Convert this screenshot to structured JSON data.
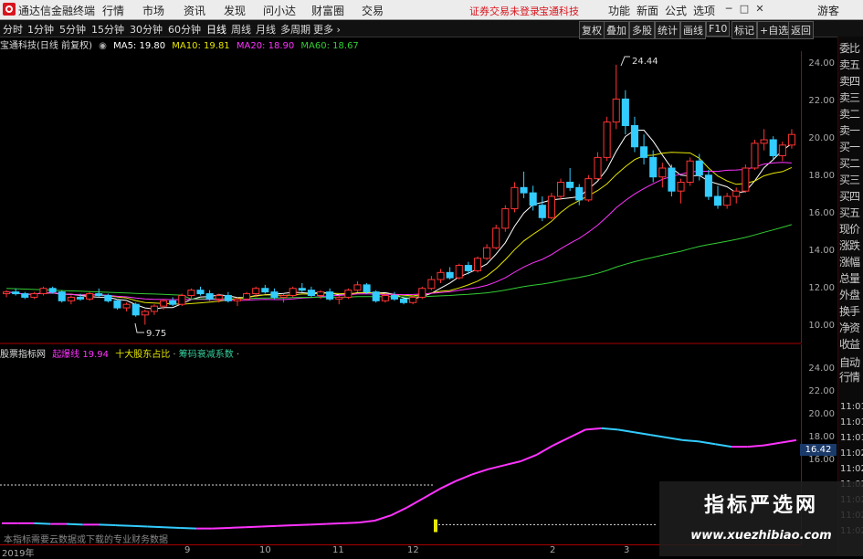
{
  "window": {
    "app_title": "通达信金融终端",
    "menu": [
      "行情",
      "市场",
      "资讯",
      "发现",
      "问小达",
      "财富圈",
      "交易"
    ],
    "notice": "证券交易未登录",
    "notice_stock": "宝通科技",
    "right_menu": [
      "功能",
      "新面",
      "公式",
      "选项"
    ],
    "guest": "游客"
  },
  "periods": [
    "分时",
    "1分钟",
    "5分钟",
    "15分钟",
    "30分钟",
    "60分钟",
    "日线",
    "周线",
    "月线",
    "多周期",
    "更多 ›"
  ],
  "active_period": "日线",
  "right_tools": [
    "复权",
    "叠加",
    "多股",
    "统计",
    "画线",
    "F10",
    "标记",
    "+自选",
    "返回"
  ],
  "main_info": {
    "stock": "宝通科技(日线 前复权)",
    "ma5": "MA5: 19.80",
    "ma10": "MA10: 19.81",
    "ma20": "MA20: 18.90",
    "ma60": "MA60: 18.67"
  },
  "price_axis": [
    "24.00",
    "22.00",
    "20.00",
    "18.00",
    "16.00",
    "14.00",
    "12.00",
    "10.00"
  ],
  "annotations": {
    "high": "24.44",
    "low": "9.75"
  },
  "sub_info": {
    "source": "股票指标网",
    "line_name": "起爆线",
    "line_value": "19.94",
    "holder": "十大股东占比",
    "chip": "筹码衰减系数"
  },
  "sub_axis": [
    "24.00",
    "22.00",
    "20.00",
    "18.00",
    "16.00"
  ],
  "current_value": "16.42",
  "side_panel": [
    "委比",
    "卖五",
    "卖四",
    "卖三",
    "卖二",
    "卖一",
    "买一",
    "买二",
    "买三",
    "买四",
    "买五",
    "现价",
    "涨跌",
    "涨幅",
    "总量",
    "外盘",
    "换手",
    "净资",
    "收益"
  ],
  "side_bottom": [
    "自动",
    "行情"
  ],
  "side_times": [
    "11:01",
    "11:01",
    "11:01",
    "11:02",
    "11:02",
    "11:02",
    "11:02",
    "11:02",
    "11:02"
  ],
  "bottom_note": "本指标需要云数据或下载的专业财务数据",
  "x_axis": [
    "2019年",
    "9",
    "10",
    "11",
    "12",
    "2",
    "3"
  ],
  "watermark": {
    "title": "指标严选网",
    "url": "www.xuezhibiao.com"
  },
  "colors": {
    "ma5": "#ffffff",
    "ma10": "#e6e600",
    "ma20": "#ff33ff",
    "ma60": "#33cc33",
    "up": "#ff3333",
    "down": "#33ccff",
    "sub_up": "#ff33ff",
    "sub_down": "#33ccff"
  },
  "chart_data": {
    "type": "candlestick",
    "ylim": [
      9,
      25
    ],
    "sub_ylim": [
      14,
      26
    ],
    "candles": [
      [
        11.5,
        11.7,
        11.3,
        11.6
      ],
      [
        11.6,
        11.8,
        11.4,
        11.5
      ],
      [
        11.5,
        11.6,
        11.2,
        11.3
      ],
      [
        11.3,
        11.6,
        11.2,
        11.5
      ],
      [
        11.5,
        11.9,
        11.4,
        11.8
      ],
      [
        11.8,
        11.9,
        11.5,
        11.6
      ],
      [
        11.6,
        11.7,
        11.0,
        11.1
      ],
      [
        11.1,
        11.4,
        10.9,
        11.3
      ],
      [
        11.3,
        11.5,
        11.1,
        11.2
      ],
      [
        11.2,
        11.6,
        11.1,
        11.5
      ],
      [
        11.5,
        11.8,
        11.3,
        11.4
      ],
      [
        11.4,
        11.5,
        11.0,
        11.1
      ],
      [
        11.1,
        11.2,
        10.6,
        10.7
      ],
      [
        10.7,
        11.0,
        10.5,
        10.9
      ],
      [
        10.9,
        11.0,
        10.2,
        10.3
      ],
      [
        10.3,
        10.6,
        9.75,
        10.5
      ],
      [
        10.5,
        10.9,
        10.3,
        10.8
      ],
      [
        10.8,
        11.2,
        10.6,
        11.1
      ],
      [
        11.1,
        11.3,
        10.8,
        10.9
      ],
      [
        10.9,
        11.5,
        10.8,
        11.4
      ],
      [
        11.4,
        11.8,
        11.2,
        11.7
      ],
      [
        11.7,
        11.9,
        11.4,
        11.5
      ],
      [
        11.5,
        11.7,
        11.1,
        11.2
      ],
      [
        11.2,
        11.5,
        11.0,
        11.4
      ],
      [
        11.4,
        11.6,
        11.0,
        11.1
      ],
      [
        11.1,
        11.3,
        10.8,
        11.2
      ],
      [
        11.2,
        11.6,
        11.1,
        11.5
      ],
      [
        11.5,
        11.9,
        11.3,
        11.8
      ],
      [
        11.8,
        12.0,
        11.5,
        11.6
      ],
      [
        11.6,
        11.8,
        11.2,
        11.3
      ],
      [
        11.3,
        11.5,
        11.0,
        11.4
      ],
      [
        11.4,
        11.9,
        11.3,
        11.8
      ],
      [
        11.8,
        12.1,
        11.6,
        11.7
      ],
      [
        11.7,
        11.9,
        11.3,
        11.4
      ],
      [
        11.4,
        11.7,
        11.2,
        11.6
      ],
      [
        11.6,
        11.8,
        11.1,
        11.2
      ],
      [
        11.2,
        11.4,
        10.9,
        11.3
      ],
      [
        11.3,
        11.8,
        11.2,
        11.7
      ],
      [
        11.7,
        12.2,
        11.6,
        12.0
      ],
      [
        12.0,
        12.1,
        11.5,
        11.6
      ],
      [
        11.6,
        11.7,
        11.0,
        11.1
      ],
      [
        11.1,
        11.5,
        11.0,
        11.4
      ],
      [
        11.4,
        11.6,
        11.1,
        11.2
      ],
      [
        11.2,
        11.3,
        10.9,
        11.0
      ],
      [
        11.0,
        11.4,
        10.9,
        11.3
      ],
      [
        11.3,
        11.9,
        11.2,
        11.8
      ],
      [
        11.8,
        12.5,
        11.7,
        12.3
      ],
      [
        12.3,
        12.9,
        12.1,
        12.7
      ],
      [
        12.7,
        13.0,
        12.3,
        12.4
      ],
      [
        12.4,
        13.2,
        12.3,
        13.1
      ],
      [
        13.1,
        13.3,
        12.6,
        12.8
      ],
      [
        12.8,
        13.6,
        12.7,
        13.5
      ],
      [
        13.5,
        14.3,
        13.4,
        14.1
      ],
      [
        14.1,
        15.4,
        14.0,
        15.2
      ],
      [
        15.2,
        16.5,
        15.0,
        16.3
      ],
      [
        16.3,
        17.8,
        16.1,
        17.5
      ],
      [
        17.5,
        18.4,
        16.9,
        17.2
      ],
      [
        17.2,
        17.6,
        16.2,
        16.5
      ],
      [
        16.5,
        17.0,
        15.6,
        15.8
      ],
      [
        15.8,
        17.2,
        15.7,
        17.0
      ],
      [
        17.0,
        18.0,
        16.8,
        17.8
      ],
      [
        17.8,
        18.6,
        17.3,
        17.5
      ],
      [
        17.5,
        17.7,
        16.5,
        16.8
      ],
      [
        16.8,
        18.2,
        16.7,
        18.0
      ],
      [
        18.0,
        19.5,
        17.9,
        19.2
      ],
      [
        19.2,
        21.5,
        19.0,
        21.2
      ],
      [
        21.2,
        24.44,
        20.8,
        22.5
      ],
      [
        22.5,
        23.0,
        20.5,
        21.0
      ],
      [
        21.0,
        21.5,
        19.5,
        19.8
      ],
      [
        19.8,
        20.5,
        18.8,
        19.2
      ],
      [
        19.2,
        19.6,
        17.8,
        18.1
      ],
      [
        18.1,
        18.9,
        17.5,
        18.6
      ],
      [
        18.6,
        18.8,
        17.0,
        17.3
      ],
      [
        17.3,
        18.0,
        16.6,
        17.8
      ],
      [
        17.8,
        19.2,
        17.6,
        19.0
      ],
      [
        19.0,
        19.4,
        17.9,
        18.2
      ],
      [
        18.2,
        18.5,
        16.8,
        17.0
      ],
      [
        17.0,
        17.6,
        16.3,
        16.5
      ],
      [
        16.5,
        17.2,
        16.3,
        17.0
      ],
      [
        17.0,
        17.5,
        16.6,
        17.3
      ],
      [
        17.3,
        18.8,
        17.2,
        18.6
      ],
      [
        18.6,
        20.2,
        18.5,
        20.0
      ],
      [
        20.0,
        20.8,
        19.6,
        20.2
      ],
      [
        20.2,
        20.4,
        19.1,
        19.3
      ],
      [
        19.3,
        20.1,
        19.0,
        19.9
      ],
      [
        19.9,
        20.8,
        19.7,
        20.5
      ]
    ],
    "sub_line": [
      14.1,
      14.1,
      14.1,
      14.05,
      14.05,
      14.0,
      14.0,
      13.95,
      13.9,
      13.85,
      13.8,
      13.75,
      13.7,
      13.7,
      13.75,
      13.8,
      13.85,
      13.9,
      13.95,
      14.0,
      14.05,
      14.1,
      14.15,
      14.3,
      14.7,
      15.3,
      16.0,
      16.7,
      17.3,
      17.8,
      18.2,
      18.5,
      18.8,
      19.3,
      20.0,
      20.6,
      21.2,
      21.3,
      21.2,
      21.0,
      20.8,
      20.6,
      20.4,
      20.3,
      20.1,
      19.9,
      19.9,
      20.0,
      20.2,
      20.4
    ],
    "white_dashed_levels": [
      17.0,
      14.0
    ]
  }
}
